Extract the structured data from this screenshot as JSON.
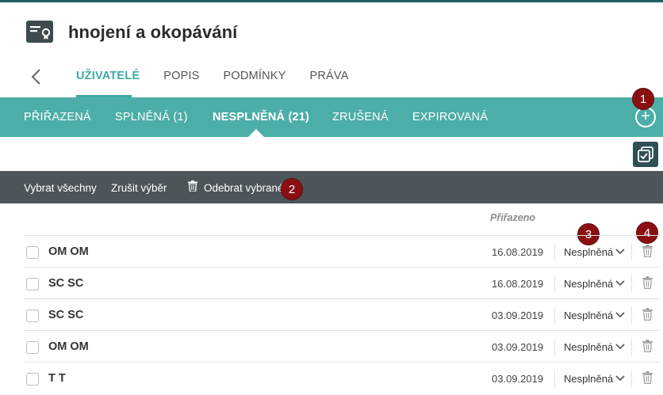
{
  "header": {
    "title": "hnojení a okopávání"
  },
  "tabs": [
    {
      "label": "UŽIVATELÉ",
      "active": true
    },
    {
      "label": "POPIS",
      "active": false
    },
    {
      "label": "PODMÍNKY",
      "active": false
    },
    {
      "label": "PRÁVA",
      "active": false
    }
  ],
  "subtabs": [
    {
      "label": "PŘIŘAZENÁ"
    },
    {
      "label": "SPLNĚNÁ (1)"
    },
    {
      "label": "NESPLNĚNÁ (21)",
      "active": true
    },
    {
      "label": "ZRUŠENÁ"
    },
    {
      "label": "EXPIROVANÁ"
    }
  ],
  "actions": {
    "select_all": "Vybrat všechny",
    "deselect": "Zrušit výběr",
    "remove_selected": "Odebrat vybrané"
  },
  "table": {
    "assigned_header": "Přiřazeno",
    "rows": [
      {
        "name": "OM OM",
        "date": "16.08.2019",
        "status": "Nesplněná"
      },
      {
        "name": "SC SC",
        "date": "16.08.2019",
        "status": "Nesplněná"
      },
      {
        "name": "SC SC",
        "date": "03.09.2019",
        "status": "Nesplněná"
      },
      {
        "name": "OM OM",
        "date": "03.09.2019",
        "status": "Nesplněná"
      },
      {
        "name": "T T",
        "date": "03.09.2019",
        "status": "Nesplněná"
      }
    ]
  },
  "badges": [
    "1",
    "2",
    "3",
    "4"
  ],
  "colors": {
    "teal": "#4caea7",
    "tab_accent": "#3ea9a1",
    "action_bar": "#4c5559",
    "badge": "#8a0f13"
  }
}
